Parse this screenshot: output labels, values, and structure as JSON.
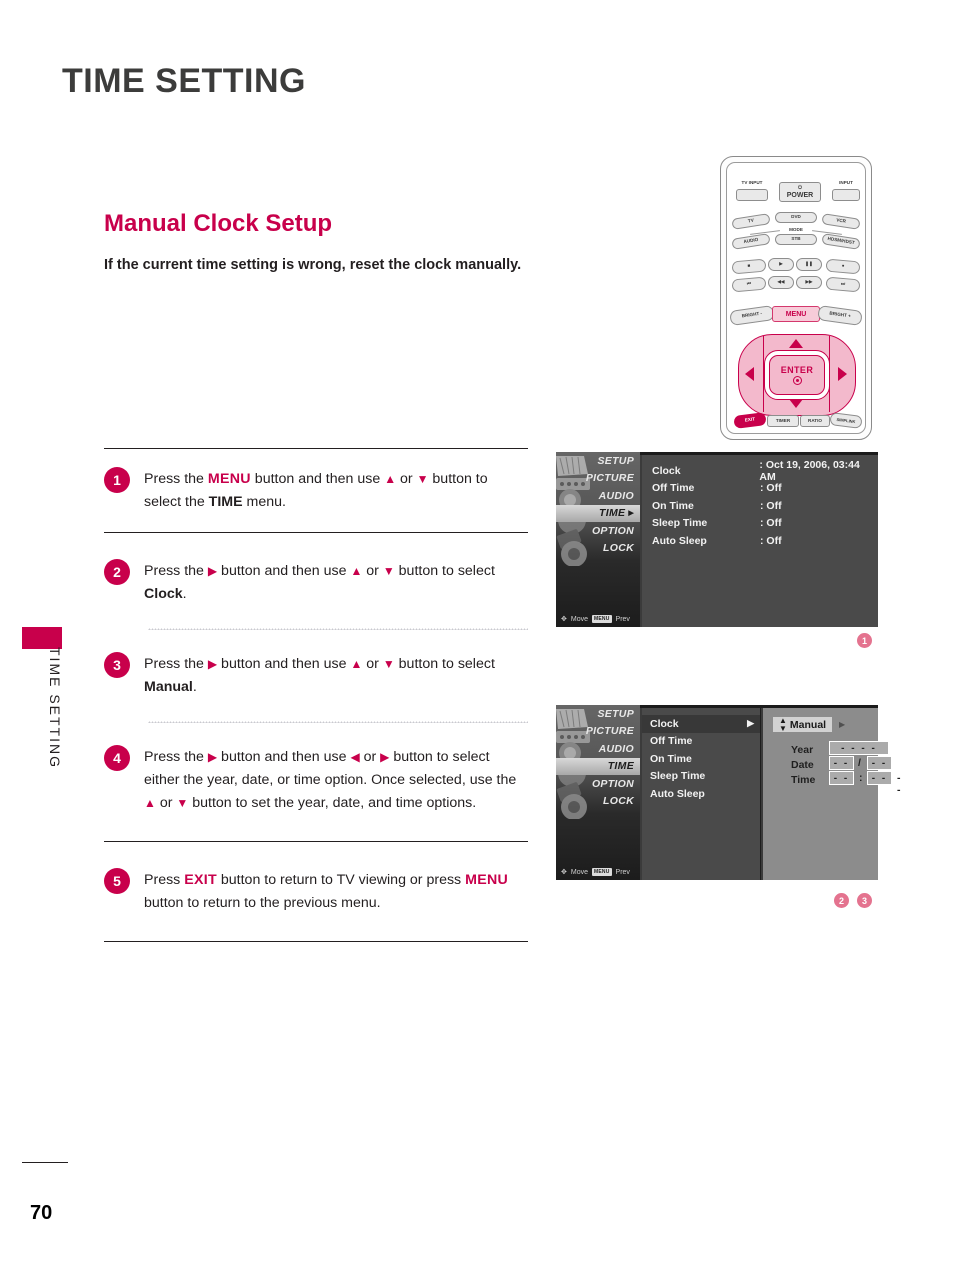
{
  "page": {
    "title": "TIME SETTING",
    "side_tab_label": "TIME SETTING",
    "page_number": "70",
    "accent_color": "#c8004b"
  },
  "section": {
    "heading": "Manual Clock Setup",
    "intro": "If the current time setting is wrong, reset the clock manually."
  },
  "steps": [
    {
      "number": "1",
      "parts": [
        {
          "t": "Press the ",
          "s": "n"
        },
        {
          "t": "MENU",
          "s": "k"
        },
        {
          "t": " button and then use ",
          "s": "n"
        },
        {
          "t": "▲",
          "s": "a"
        },
        {
          "t": " or ",
          "s": "n"
        },
        {
          "t": "▼",
          "s": "a"
        },
        {
          "t": " button to select the ",
          "s": "n"
        },
        {
          "t": "TIME",
          "s": "b"
        },
        {
          "t": " menu.",
          "s": "n"
        }
      ]
    },
    {
      "number": "2",
      "parts": [
        {
          "t": "Press the ",
          "s": "n"
        },
        {
          "t": "▶",
          "s": "a"
        },
        {
          "t": " button and then use ",
          "s": "n"
        },
        {
          "t": "▲",
          "s": "a"
        },
        {
          "t": " or ",
          "s": "n"
        },
        {
          "t": "▼",
          "s": "a"
        },
        {
          "t": " button to select ",
          "s": "n"
        },
        {
          "t": "Clock",
          "s": "b"
        },
        {
          "t": ".",
          "s": "n"
        }
      ]
    },
    {
      "number": "3",
      "parts": [
        {
          "t": "Press the ",
          "s": "n"
        },
        {
          "t": "▶",
          "s": "a"
        },
        {
          "t": " button and then use ",
          "s": "n"
        },
        {
          "t": "▲",
          "s": "a"
        },
        {
          "t": " or ",
          "s": "n"
        },
        {
          "t": "▼",
          "s": "a"
        },
        {
          "t": " button to select ",
          "s": "n"
        },
        {
          "t": "Manual",
          "s": "b"
        },
        {
          "t": ".",
          "s": "n"
        }
      ]
    },
    {
      "number": "4",
      "parts": [
        {
          "t": "Press the ",
          "s": "n"
        },
        {
          "t": "▶",
          "s": "a"
        },
        {
          "t": " button and then use ",
          "s": "n"
        },
        {
          "t": "◀",
          "s": "a"
        },
        {
          "t": " or ",
          "s": "n"
        },
        {
          "t": "▶",
          "s": "a"
        },
        {
          "t": " button to select either the year, date, or time option. Once selected, use the ",
          "s": "n"
        },
        {
          "t": "▲",
          "s": "a"
        },
        {
          "t": " or ",
          "s": "n"
        },
        {
          "t": "▼",
          "s": "a"
        },
        {
          "t": " button to set the year, date, and time options.",
          "s": "n"
        }
      ]
    },
    {
      "number": "5",
      "parts": [
        {
          "t": "Press ",
          "s": "n"
        },
        {
          "t": "EXIT",
          "s": "k"
        },
        {
          "t": " button to return to TV viewing or press ",
          "s": "n"
        },
        {
          "t": "MENU",
          "s": "k"
        },
        {
          "t": " button to return to the previous menu.",
          "s": "n"
        }
      ]
    }
  ],
  "remote": {
    "buttons": [
      {
        "name": "tv-input",
        "label": "TV INPUT"
      },
      {
        "name": "power",
        "label": "POWER"
      },
      {
        "name": "input",
        "label": "INPUT"
      },
      {
        "name": "tv",
        "label": "TV"
      },
      {
        "name": "dvd",
        "label": "DVD"
      },
      {
        "name": "vcr",
        "label": "VCR"
      },
      {
        "name": "mode",
        "label": "MODE"
      },
      {
        "name": "audio",
        "label": "AUDIO"
      },
      {
        "name": "stb",
        "label": "STB"
      },
      {
        "name": "hdstb-hddvd",
        "label": "HDSM/HDST"
      },
      {
        "name": "stop",
        "label": "■"
      },
      {
        "name": "play",
        "label": "▶"
      },
      {
        "name": "pause",
        "label": "❚❚"
      },
      {
        "name": "record",
        "label": "●"
      },
      {
        "name": "prev-track",
        "label": "⏮"
      },
      {
        "name": "rewind",
        "label": "◀◀"
      },
      {
        "name": "fast-forward",
        "label": "▶▶"
      },
      {
        "name": "next-track",
        "label": "⏭"
      },
      {
        "name": "bright-minus",
        "label": "BRIGHT -"
      },
      {
        "name": "menu",
        "label": "MENU"
      },
      {
        "name": "bright-plus",
        "label": "BRIGHT +"
      },
      {
        "name": "enter",
        "label": "ENTER"
      },
      {
        "name": "exit",
        "label": "EXIT"
      },
      {
        "name": "timer",
        "label": "TIMER"
      },
      {
        "name": "ratio",
        "label": "RATIO"
      },
      {
        "name": "simplink",
        "label": "SIMPLINK"
      }
    ]
  },
  "osd1": {
    "sidebar": [
      "SETUP",
      "PICTURE",
      "AUDIO",
      "TIME",
      "OPTION",
      "LOCK"
    ],
    "selected": "TIME",
    "footer": {
      "move": "Move",
      "chip": "MENU",
      "prev": "Prev"
    },
    "rows": [
      {
        "name": "Clock",
        "value": ": Oct 19, 2006, 03:44 AM"
      },
      {
        "name": "Off Time",
        "value": ": Off"
      },
      {
        "name": "On Time",
        "value": ": Off"
      },
      {
        "name": "Sleep Time",
        "value": ": Off"
      },
      {
        "name": "Auto Sleep",
        "value": ": Off"
      }
    ],
    "callout": "1"
  },
  "osd2": {
    "sidebar": [
      "SETUP",
      "PICTURE",
      "AUDIO",
      "TIME",
      "OPTION",
      "LOCK"
    ],
    "selected": "TIME",
    "footer": {
      "move": "Move",
      "chip": "MENU",
      "prev": "Prev"
    },
    "items": [
      "Clock",
      "Off Time",
      "On Time",
      "Sleep Time",
      "Auto Sleep"
    ],
    "selected_item": "Clock",
    "panel": {
      "mode_label": "Manual",
      "fields": [
        {
          "label": "Year",
          "value": "- - - -"
        },
        {
          "label": "Date",
          "value_a": "- -",
          "separator": "/",
          "value_b": "- -"
        },
        {
          "label": "Time",
          "value_a": "- -",
          "separator": ":",
          "value_b": "- -",
          "suffix": "- -"
        }
      ]
    },
    "callouts": [
      "2",
      "3"
    ]
  }
}
